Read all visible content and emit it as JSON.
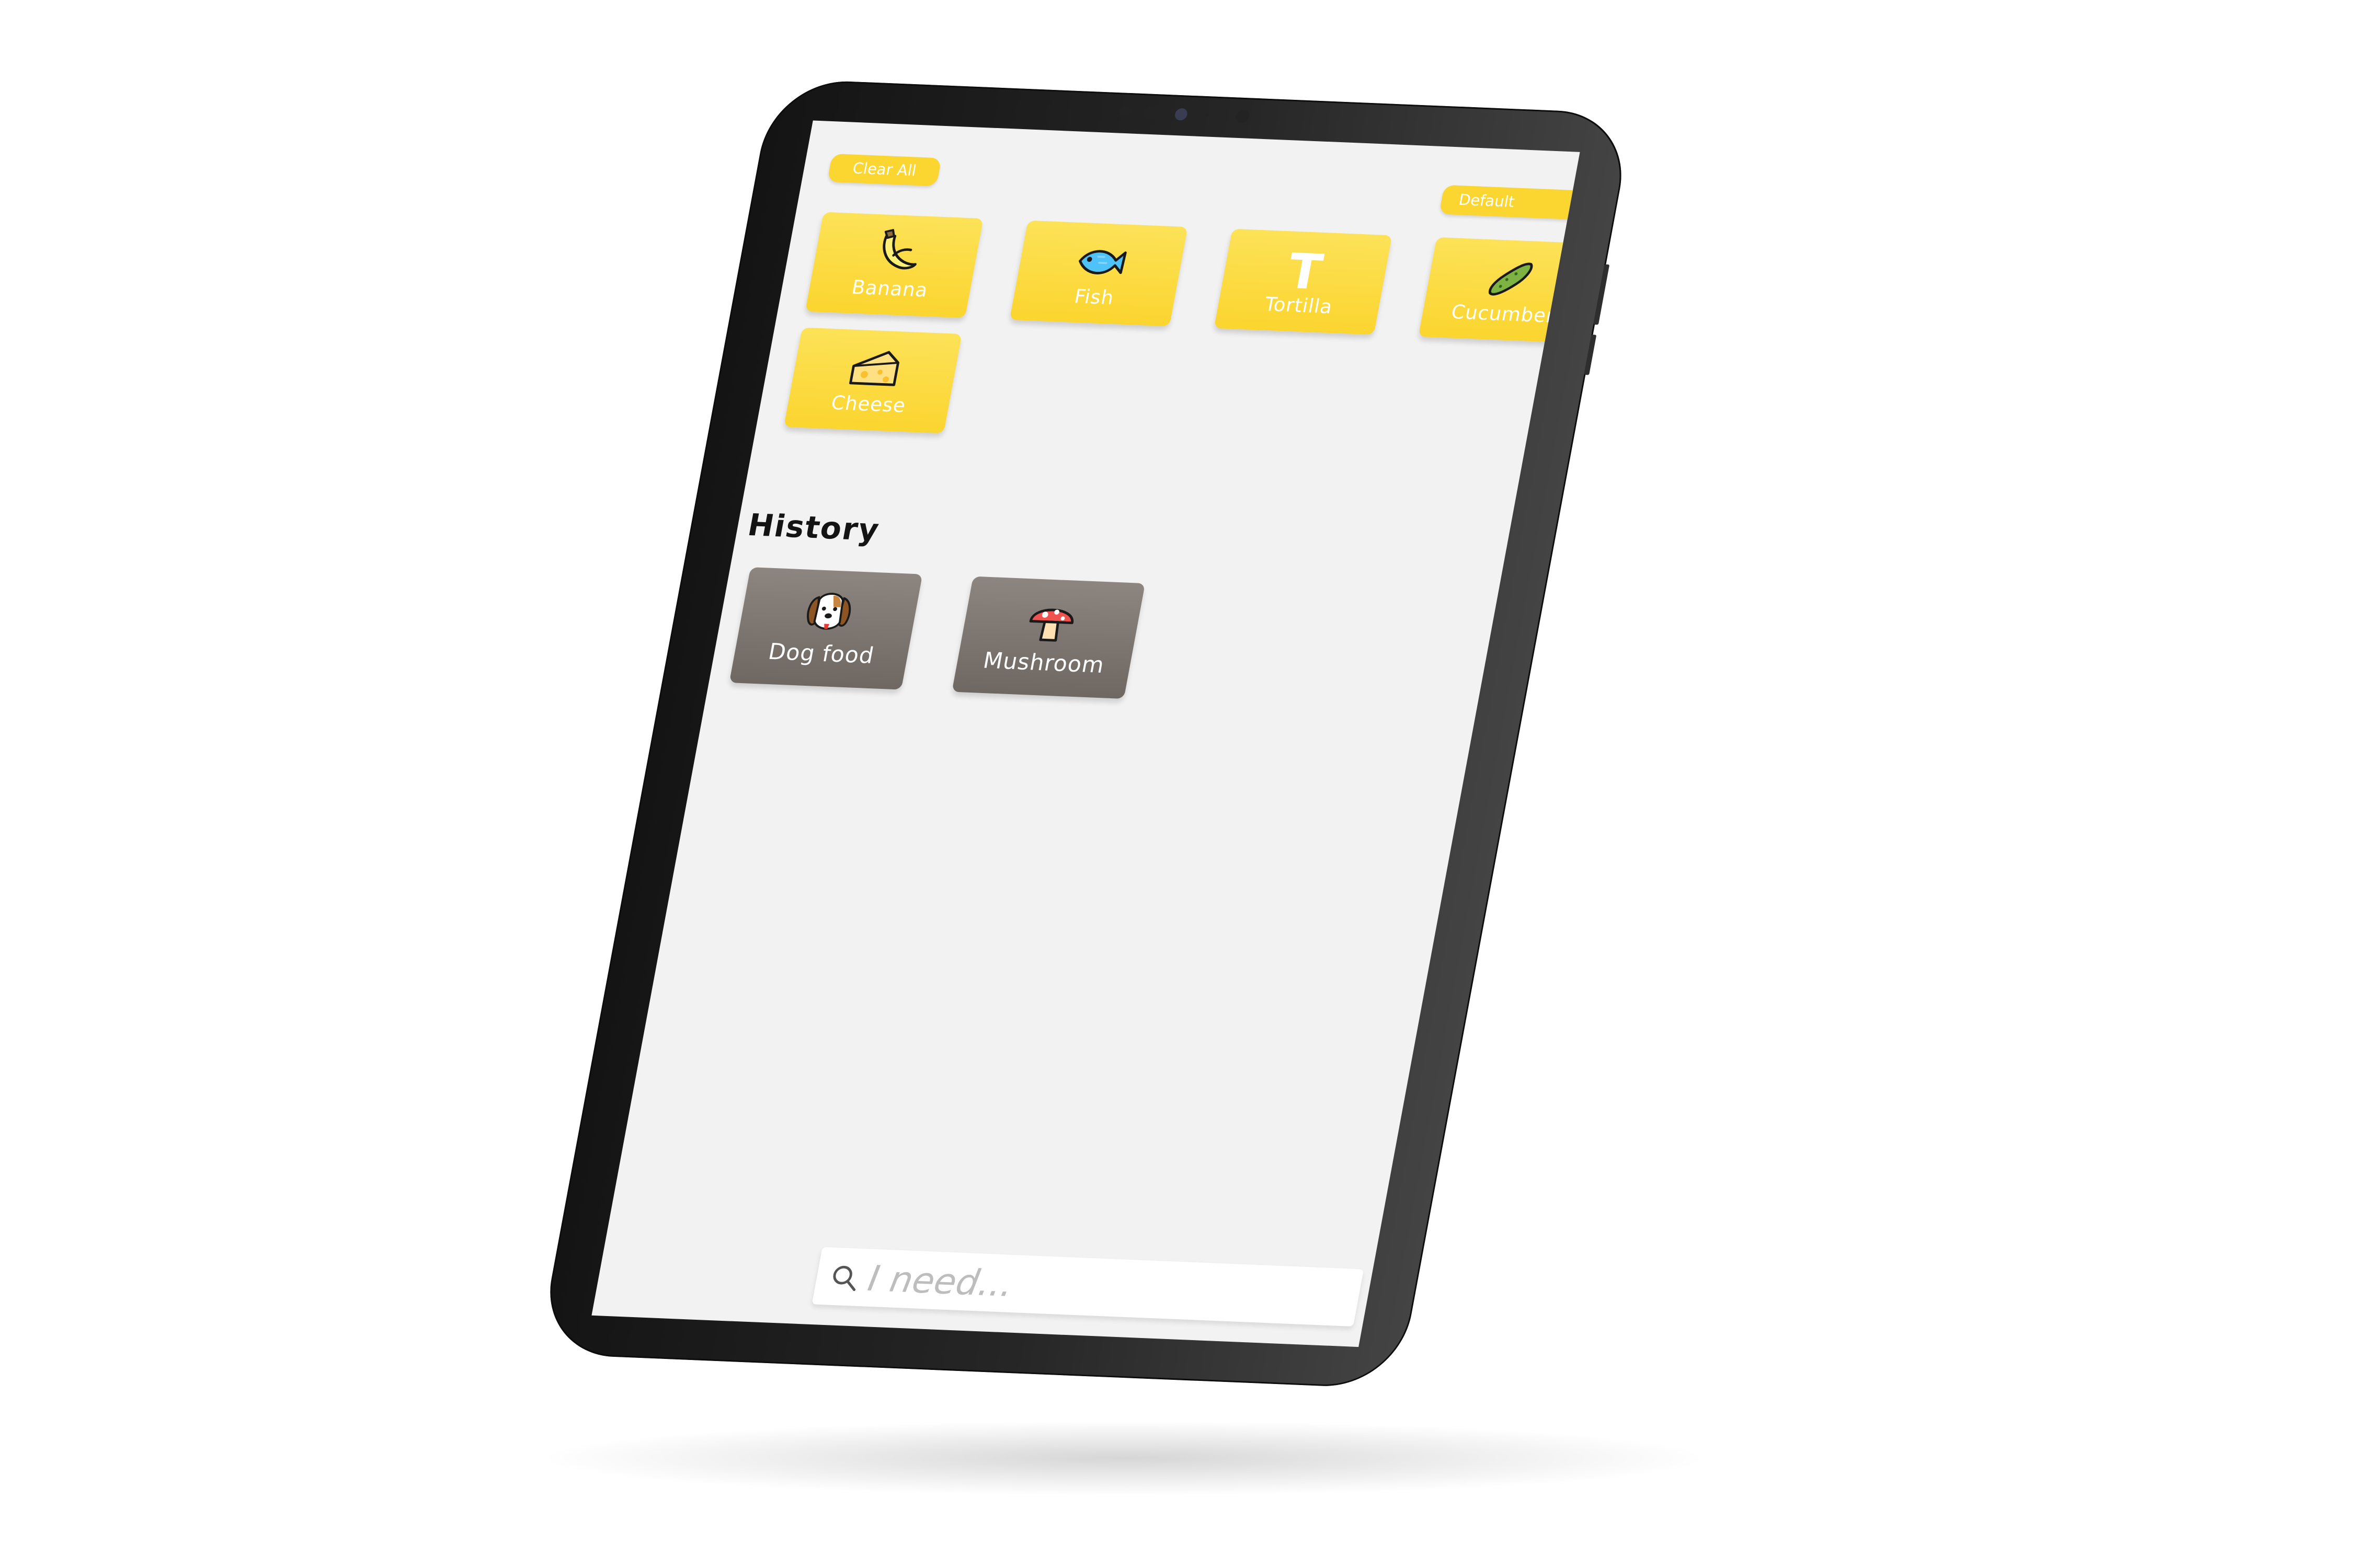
{
  "toolbar": {
    "clear_all_label": "Clear All",
    "sort_selected": "Default",
    "sort_chevron": "⌄"
  },
  "list": {
    "items": [
      {
        "label": "Banana",
        "icon": "banana-icon"
      },
      {
        "label": "Fish",
        "icon": "fish-icon"
      },
      {
        "label": "Tortilla",
        "icon": "tortilla-letter-t-icon"
      },
      {
        "label": "Cucumber",
        "icon": "cucumber-icon"
      },
      {
        "label": "Cheese",
        "icon": "cheese-icon"
      }
    ],
    "tortilla_icon_letter": "T"
  },
  "history": {
    "title": "History",
    "items": [
      {
        "label": "Dog food",
        "icon": "dog-icon"
      },
      {
        "label": "Mushroom",
        "icon": "mushroom-icon"
      }
    ]
  },
  "search": {
    "placeholder": "I need...",
    "value": ""
  },
  "add_button": {
    "icon": "plus-icon"
  },
  "colors": {
    "accent": "#fbd530",
    "history_tile": "#7d7671",
    "screen_background": "#f2f2f2",
    "bezel": "#1c1c1c"
  }
}
